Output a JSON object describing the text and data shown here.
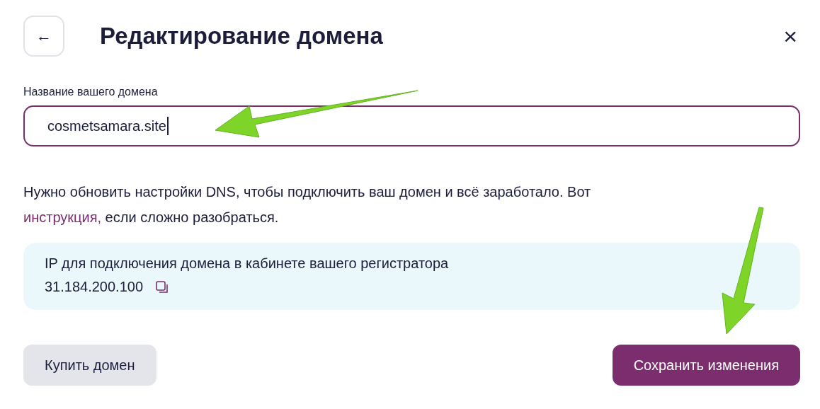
{
  "dialog": {
    "back_label": "←",
    "title": "Редактирование домена",
    "close_label": "×"
  },
  "domain_field": {
    "label": "Название вашего домена",
    "value": "cosmetsamara.site",
    "focused": true
  },
  "notice": {
    "text": "Нужно обновить настройки DNS, чтобы подключить ваш домен и всё заработало. Вот",
    "link": "инструкция,",
    "text_after": "если сложно разобраться."
  },
  "ip_box": {
    "caption": "IP для подключения домена в кабинете вашего регистратора",
    "ip": "31.184.200.100"
  },
  "buttons": [
    {
      "label": "Купить домен",
      "kind": "secondary"
    },
    {
      "label": "Сохранить изменения",
      "kind": "primary"
    }
  ]
}
